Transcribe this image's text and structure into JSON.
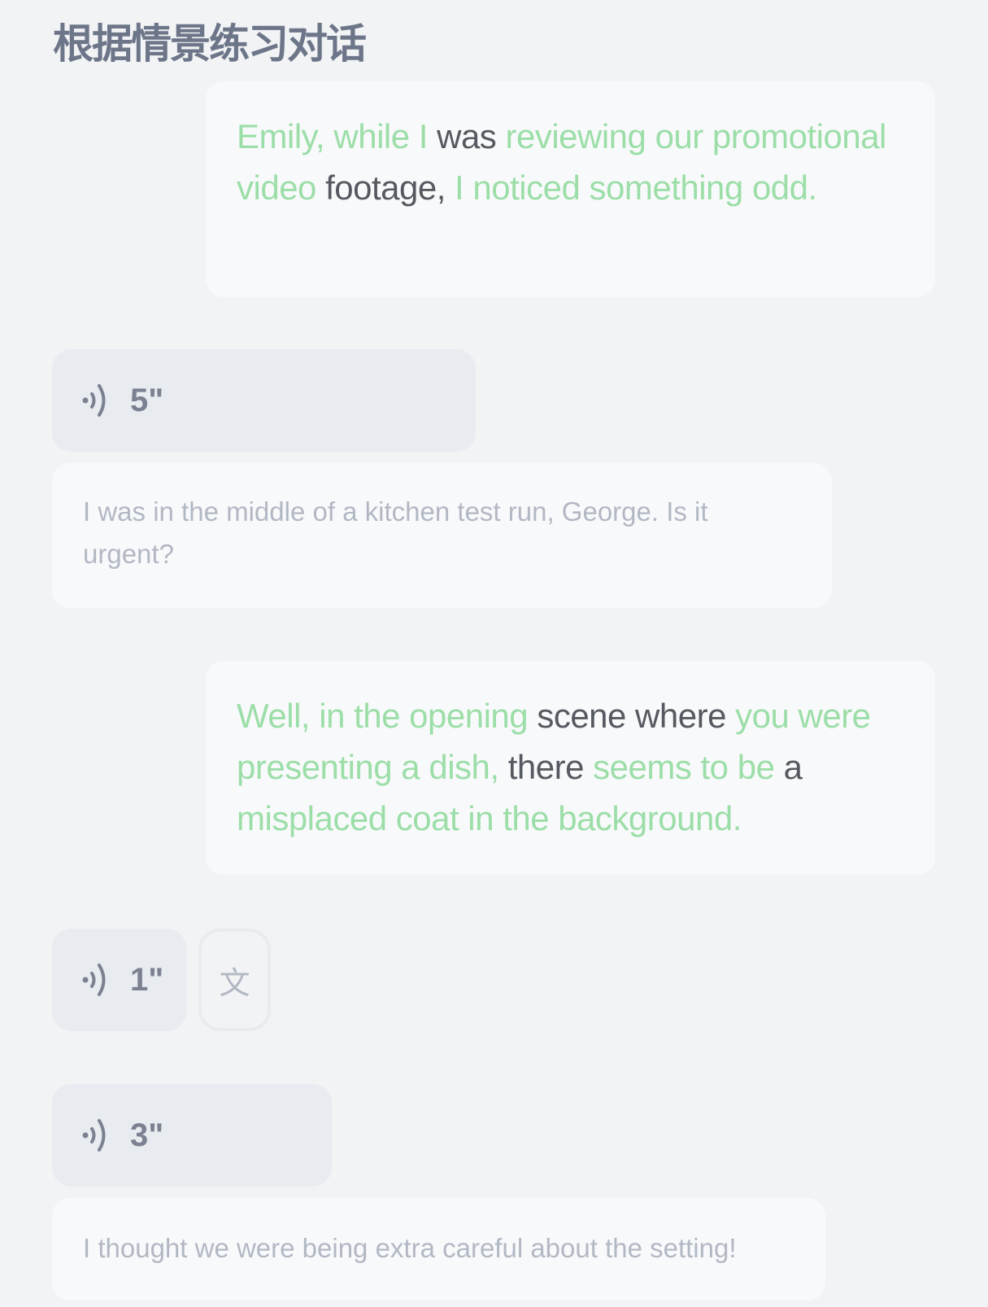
{
  "title": "根据情景练习对话",
  "messages": [
    {
      "segments": [
        {
          "t": "Emily, while I ",
          "c": "g"
        },
        {
          "t": "was",
          "c": "d"
        },
        {
          "t": " reviewing our promotional video ",
          "c": "g"
        },
        {
          "t": "footage,",
          "c": "d"
        },
        {
          "t": " I noticed something odd.",
          "c": "g"
        }
      ]
    },
    {
      "voice_duration": "5\"",
      "text": "I was in the middle of a kitchen test run, George. Is it urgent?"
    },
    {
      "segments": [
        {
          "t": "Well, in the opening ",
          "c": "g"
        },
        {
          "t": "scene where",
          "c": "d"
        },
        {
          "t": " you were presenting a dish,",
          "c": "g"
        },
        {
          "t": " there",
          "c": "d"
        },
        {
          "t": " seems to be",
          "c": "g"
        },
        {
          "t": " a",
          "c": "d"
        },
        {
          "t": " misplaced coat in the background.",
          "c": "g"
        }
      ]
    },
    {
      "voice_duration": "1\"",
      "translate_label": "文"
    },
    {
      "voice_duration": "3\"",
      "text": "I thought we were being extra careful about the setting!"
    }
  ]
}
